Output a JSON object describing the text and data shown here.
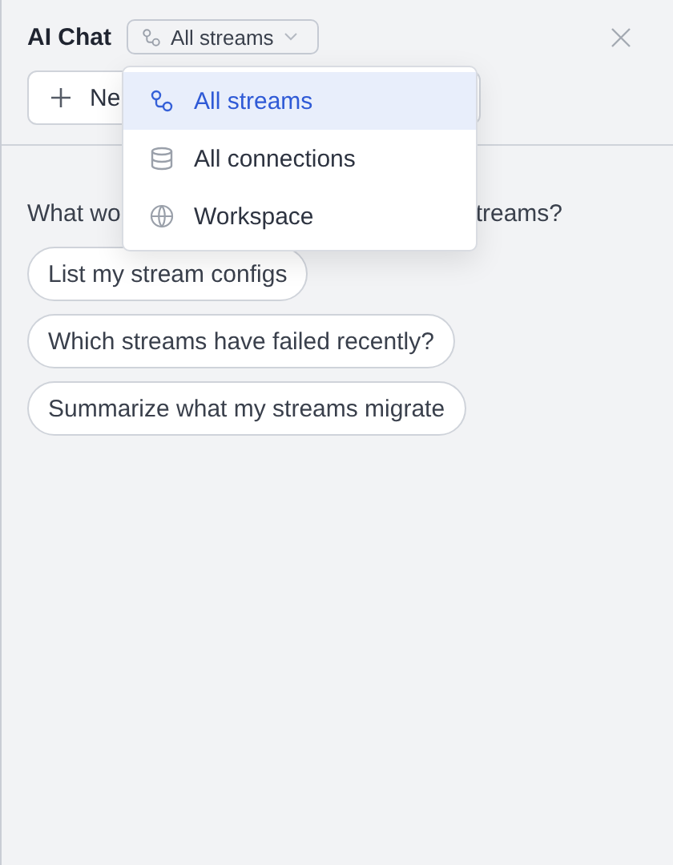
{
  "header": {
    "title": "AI Chat",
    "scope_select": {
      "label": "All streams"
    }
  },
  "new_button": {
    "label": "Ne"
  },
  "question": {
    "before": "What wo",
    "after": "treams?"
  },
  "suggestions": [
    {
      "label": "List my stream configs"
    },
    {
      "label": "Which streams have failed recently?"
    },
    {
      "label": "Summarize what my streams migrate"
    }
  ],
  "menu": {
    "items": [
      {
        "kind": "streams",
        "label": "All streams",
        "selected": true
      },
      {
        "kind": "database",
        "label": "All connections",
        "selected": false
      },
      {
        "kind": "globe",
        "label": "Workspace",
        "selected": false
      }
    ]
  }
}
